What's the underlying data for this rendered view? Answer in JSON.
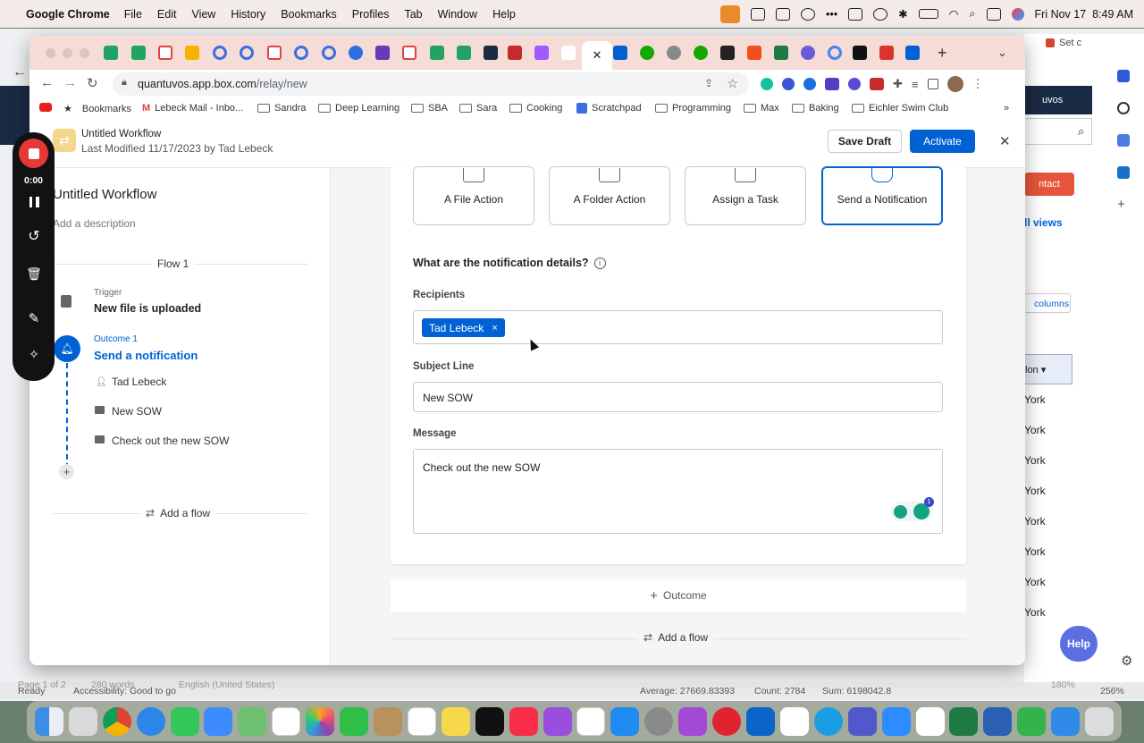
{
  "menubar": {
    "app_name": "Google Chrome",
    "menus": [
      "File",
      "Edit",
      "View",
      "History",
      "Bookmarks",
      "Profiles",
      "Tab",
      "Window",
      "Help"
    ],
    "clock": "Fri Nov 17  8:49 AM"
  },
  "browser": {
    "url_host": "quantuvos.app.box.com",
    "url_path": "/relay/new",
    "bookmarks": {
      "items": [
        "Bookmarks",
        "Lebeck Mail - Inbo...",
        "Sandra",
        "Deep Learning",
        "SBA",
        "Sara",
        "Cooking",
        "Scratchpad",
        "Programming",
        "Max",
        "Baking",
        "Eichler Swim Club"
      ],
      "overflow": "»"
    },
    "bg_tab_title": "Set c"
  },
  "header": {
    "title": "Untitled Workflow",
    "subtitle": "Last Modified 11/17/2023 by Tad Lebeck",
    "save_draft": "Save Draft",
    "activate": "Activate",
    "colors": {
      "primary": "#0061d5"
    }
  },
  "recorder": {
    "time": "0:00"
  },
  "left": {
    "workflow_title": "Untitled Workflow",
    "description_placeholder": "Add a description",
    "flow_label": "Flow 1",
    "trigger_label": "Trigger",
    "trigger_value": "New file is uploaded",
    "outcome_label": "Outcome 1",
    "outcome_value": "Send a notification",
    "details": [
      "Tad Lebeck",
      "New SOW",
      "Check out the new SOW"
    ],
    "add_flow": "Add a flow"
  },
  "main": {
    "actions": [
      "A File Action",
      "A Folder Action",
      "Assign a Task",
      "Send a Notification"
    ],
    "selected_action": "Send a Notification",
    "section_title": "What are the notification details?",
    "recipients_label": "Recipients",
    "recipient_chip": "Tad Lebeck",
    "chip_remove": "×",
    "subject_label": "Subject Line",
    "subject_value": "New SOW",
    "message_label": "Message",
    "message_value": "Check out the new SOW",
    "grammarly_badge": "1",
    "outcome_button": "Outcome",
    "add_flow": "Add a flow"
  },
  "background_app": {
    "partial_tab": "uvos",
    "contact_button": "ntact",
    "all_views": "ll views",
    "columns_button": "columns",
    "dropdown": "lon",
    "rows": [
      "York",
      "York",
      "York",
      "York",
      "York",
      "York",
      "York",
      "York"
    ],
    "help": "Help",
    "status": {
      "page": "Page 1 of 2",
      "words": "280 words",
      "ready": "Ready",
      "accessibility": "Accessibility: Good to go",
      "language": "English (United States)",
      "average": "Average: 27669.83393",
      "count": "Count: 2784",
      "sum": "Sum: 6198042.8",
      "zoom_word": "180%",
      "zoom_excel": "256%"
    }
  }
}
